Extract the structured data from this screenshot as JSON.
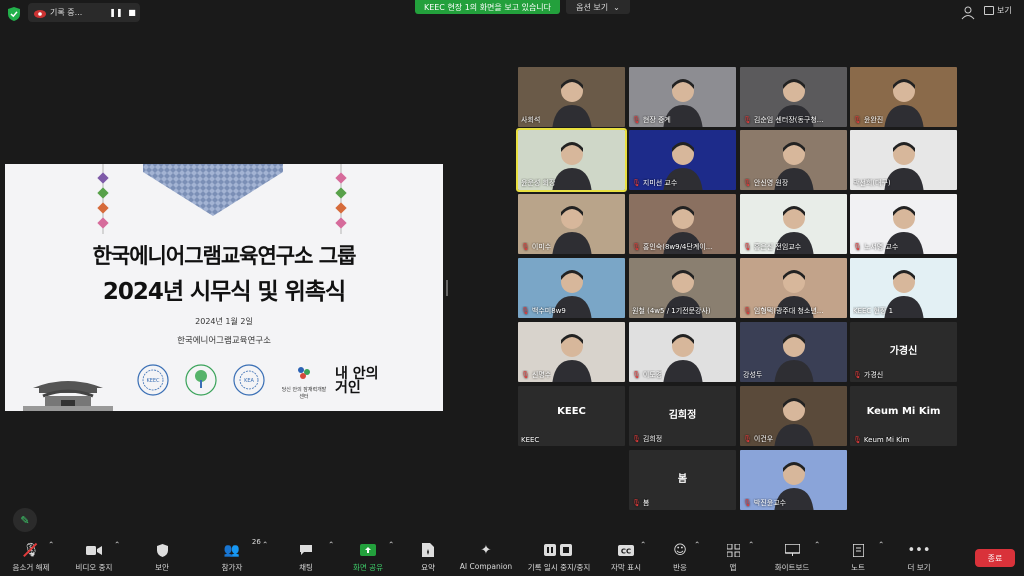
{
  "top": {
    "recording_label": "기록 중...",
    "share_banner": "KEEC 현장 1의 화면을 보고 있습니다",
    "view_options": "옵션 보기",
    "view": "보기"
  },
  "slide": {
    "title_line1": "한국에니어그램교육연구소 그룹",
    "title_line2": "2024년 시무식 및 위촉식",
    "date": "2024년 1월 2일",
    "org": "한국에니어그램교육연구소",
    "brand": "내 안의\n거인",
    "center_label": "당신 안의 잠재력개발센터"
  },
  "tiles": [
    {
      "name": "사회석",
      "muted": false
    },
    {
      "name": "현장 중계",
      "muted": true
    },
    {
      "name": "김순임 센터장(동구청...",
      "muted": true
    },
    {
      "name": "윤완진",
      "muted": true
    },
    {
      "name": "윤운성 회장",
      "muted": false
    },
    {
      "name": "지미선 교수",
      "muted": true
    },
    {
      "name": "안신영 원장",
      "muted": true
    },
    {
      "name": "박선희(대구)",
      "muted": false
    },
    {
      "name": "이미수",
      "muted": true
    },
    {
      "name": "홍인숙(8w9/4단계이...",
      "muted": true
    },
    {
      "name": "홍은신 전임교수",
      "muted": true
    },
    {
      "name": "노서영 교수",
      "muted": true
    },
    {
      "name": "백수미8w9",
      "muted": true
    },
    {
      "name": "원철 (4w5 / 1기전문강사)",
      "muted": false
    },
    {
      "name": "임형택(광주대 청소년...",
      "muted": true
    },
    {
      "name": "KEEC 현장 1",
      "muted": false
    },
    {
      "name": "신명수",
      "muted": true
    },
    {
      "name": "이도경",
      "muted": true
    },
    {
      "name": "강성두",
      "muted": false
    },
    {
      "name": "가경신",
      "muted": true,
      "display": "가경신"
    },
    {
      "name": "KEEC",
      "muted": false,
      "display": "KEEC"
    },
    {
      "name": "김희정",
      "muted": true,
      "display": "김희정"
    },
    {
      "name": "이건우",
      "muted": true
    },
    {
      "name": "Keum Mi Kim",
      "muted": true,
      "display": "Keum Mi Kim"
    },
    {
      "name": "봄",
      "muted": true,
      "display": "봄"
    },
    {
      "name": "박진윤교수",
      "muted": true
    }
  ],
  "toolbar": {
    "mute": "음소거 해제",
    "video": "비디오 중지",
    "security": "보안",
    "participants": "참가자",
    "participants_count": "26",
    "chat": "채팅",
    "share": "화면 공유",
    "summary": "요약",
    "ai": "AI Companion",
    "record": "기록 일시 중지/중지",
    "captions": "자막 표시",
    "reactions": "반응",
    "apps": "앱",
    "whiteboard": "화이트보드",
    "notes": "노트",
    "more": "더 보기",
    "end": "종료"
  },
  "colors": {
    "accent_green": "#23a03c",
    "end_red": "#d9323a",
    "mute_red": "#e23b3b",
    "active_speaker": "#e9e040"
  }
}
